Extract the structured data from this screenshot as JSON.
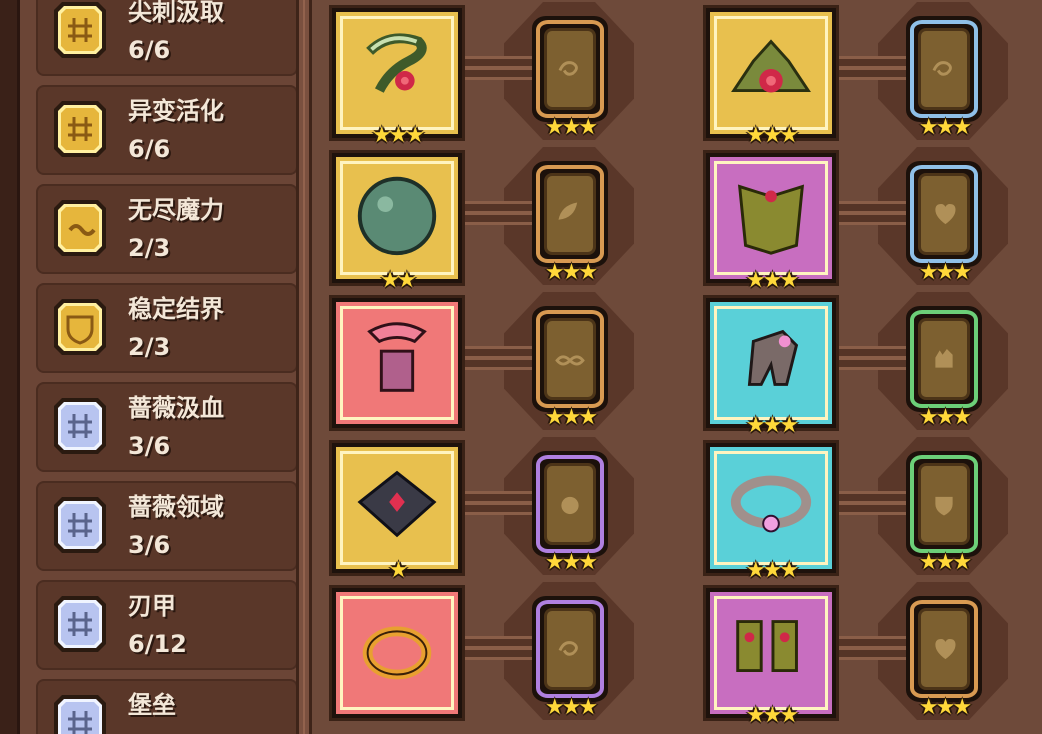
{
  "traits": [
    {
      "name": "尖刺汲取",
      "count": "6/6",
      "badge": "gold",
      "icon": "grid-icon"
    },
    {
      "name": "异变活化",
      "count": "6/6",
      "badge": "gold",
      "icon": "grid-icon"
    },
    {
      "name": "无尽魔力",
      "count": "2/3",
      "badge": "gold",
      "icon": "wave-icon"
    },
    {
      "name": "稳定结界",
      "count": "2/3",
      "badge": "gold",
      "icon": "shield-icon"
    },
    {
      "name": "蔷薇汲血",
      "count": "3/6",
      "badge": "silver",
      "icon": "grid-icon"
    },
    {
      "name": "蔷薇领域",
      "count": "3/6",
      "badge": "silver",
      "icon": "grid-icon"
    },
    {
      "name": "刃甲",
      "count": "6/12",
      "badge": "silver",
      "icon": "grid-icon"
    },
    {
      "name": "堡垒",
      "count": "",
      "badge": "silver",
      "icon": "grid-icon"
    }
  ],
  "items": [
    {
      "name": "rose-vine-bracelet",
      "bg": "#e8c04e",
      "stars": "★★★",
      "socket_color": "#d89a52",
      "socket_icon": "swirl-icon",
      "socket_stars": "★★★"
    },
    {
      "name": "rose-leaf-crown",
      "bg": "#e8c04e",
      "stars": "★★★",
      "socket_color": "#8fc0e8",
      "socket_icon": "swirl-icon",
      "socket_stars": "★★★"
    },
    {
      "name": "jade-orb",
      "bg": "#e8c04e",
      "stars": "★★",
      "socket_color": "#d89a52",
      "socket_icon": "leaf-icon",
      "socket_stars": "★★★"
    },
    {
      "name": "leaf-armor",
      "bg": "#c86ec0",
      "stars": "★★★",
      "socket_color": "#8fc0e8",
      "socket_icon": "heart-icon",
      "socket_stars": "★★★"
    },
    {
      "name": "pink-pendant",
      "bg": "#f07878",
      "stars": "",
      "socket_color": "#d89a52",
      "socket_icon": "infinity-icon",
      "socket_stars": "★★★"
    },
    {
      "name": "stone-gauntlet",
      "bg": "#5ad0d8",
      "stars": "★★★",
      "socket_color": "#6ccf78",
      "socket_icon": "hand-icon",
      "socket_stars": "★★★"
    },
    {
      "name": "dark-ruby-armor",
      "bg": "#e8c04e",
      "stars": "★",
      "socket_color": "#b080e0",
      "socket_icon": "blob-icon",
      "socket_stars": "★★★"
    },
    {
      "name": "pink-gem-necklace",
      "bg": "#5ad0d8",
      "stars": "★★★",
      "socket_color": "#6ccf78",
      "socket_icon": "shield-icon",
      "socket_stars": "★★★"
    },
    {
      "name": "gold-ring",
      "bg": "#f07878",
      "stars": "",
      "socket_color": "#b080e0",
      "socket_icon": "swirl-icon",
      "socket_stars": "★★★"
    },
    {
      "name": "leaf-boots",
      "bg": "#c86ec0",
      "stars": "★★★",
      "socket_color": "#d89a52",
      "socket_icon": "heart-icon",
      "socket_stars": "★★★"
    }
  ]
}
